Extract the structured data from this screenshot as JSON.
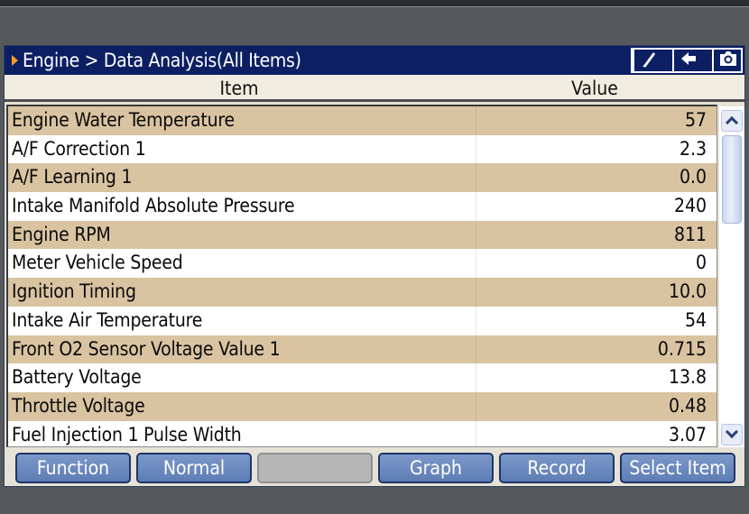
{
  "title": {
    "breadcrumb": "Engine > Data Analysis(All Items)",
    "buttons": [
      {
        "icon": "pen-icon",
        "glyph": "╱"
      },
      {
        "icon": "back-arrow-icon",
        "glyph": "←"
      },
      {
        "icon": "camera-icon",
        "glyph": "◘"
      }
    ]
  },
  "table": {
    "col_item": "Item",
    "col_value": "Value",
    "rows": [
      {
        "name": "Engine Water Temperature",
        "value": "57"
      },
      {
        "name": "A/F Correction 1",
        "value": "2.3"
      },
      {
        "name": "A/F Learning 1",
        "value": "0.0"
      },
      {
        "name": "Intake Manifold Absolute Pressure",
        "value": "240"
      },
      {
        "name": "Engine RPM",
        "value": "811"
      },
      {
        "name": "Meter Vehicle Speed",
        "value": "0"
      },
      {
        "name": "Ignition Timing",
        "value": "10.0"
      },
      {
        "name": "Intake Air Temperature",
        "value": "54"
      },
      {
        "name": "Front O2 Sensor Voltage Value 1",
        "value": "0.715"
      },
      {
        "name": "Battery Voltage",
        "value": "13.8"
      },
      {
        "name": "Throttle Voltage",
        "value": "0.48"
      },
      {
        "name": "Fuel Injection 1 Pulse Width",
        "value": "3.07"
      }
    ]
  },
  "footer": {
    "buttons": [
      {
        "label": "Function",
        "enabled": true
      },
      {
        "label": "Normal",
        "enabled": true
      },
      {
        "label": "",
        "enabled": false
      },
      {
        "label": "Graph",
        "enabled": true
      },
      {
        "label": "Record",
        "enabled": true
      },
      {
        "label": "Select Item",
        "enabled": true
      }
    ]
  },
  "colors": {
    "titlebar": "#0c1f63",
    "row_highlight": "#d9c3a1",
    "button": "#6a89bf",
    "accent_arrow": "#ff9a26"
  }
}
